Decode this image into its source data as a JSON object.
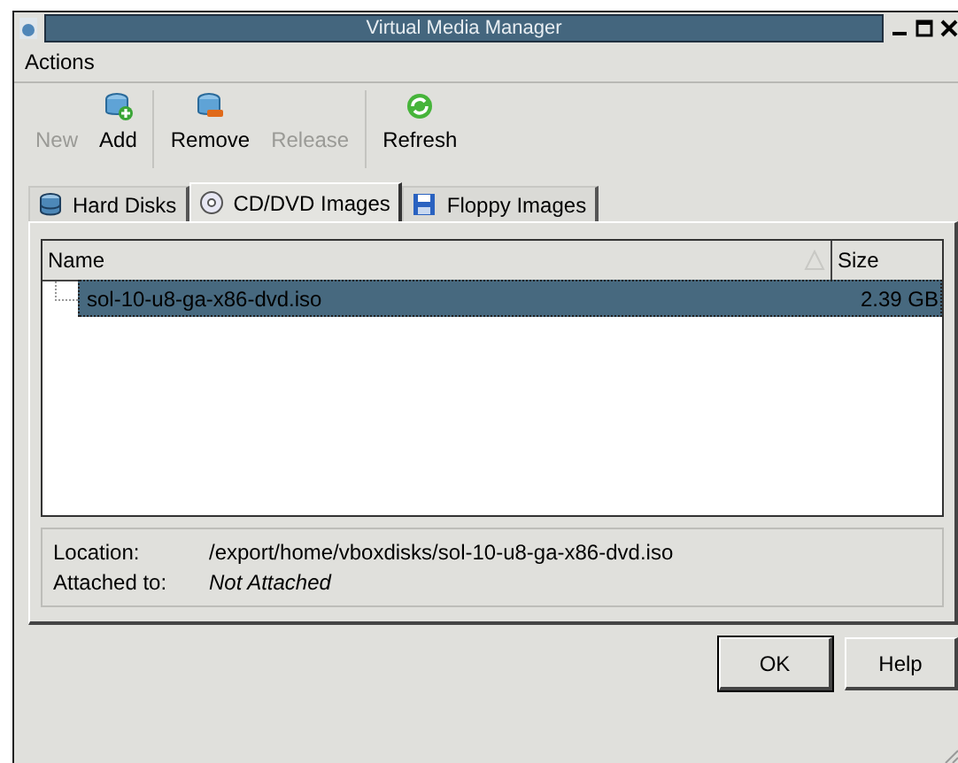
{
  "window": {
    "title": "Virtual Media Manager"
  },
  "menu": [
    "Actions"
  ],
  "toolbar": [
    {
      "label": "New",
      "kind": "plain",
      "disabled": true
    },
    {
      "label": "Add",
      "kind": "add",
      "disabled": false
    },
    {
      "label": "Remove",
      "kind": "remove",
      "disabled": false
    },
    {
      "label": "Release",
      "kind": "plain",
      "disabled": true
    },
    {
      "label": "Refresh",
      "kind": "refresh",
      "disabled": false
    }
  ],
  "tabs": [
    {
      "label": "Hard Disks",
      "kind": "disk",
      "selected": false
    },
    {
      "label": "CD/DVD Images",
      "kind": "cd",
      "selected": true
    },
    {
      "label": "Floppy Images",
      "kind": "floppy",
      "selected": false
    }
  ],
  "table": {
    "columns": [
      "Name",
      "Size"
    ],
    "rows": [
      {
        "name": "sol-10-u8-ga-x86-dvd.iso",
        "size": "2.39 GB",
        "selected": true
      }
    ]
  },
  "details": [
    {
      "label": "Location:",
      "value": "/export/home/vboxdisks/sol-10-u8-ga-x86-dvd.iso",
      "italic": false
    },
    {
      "label": "Attached to:",
      "value": "Not Attached",
      "italic": true
    }
  ],
  "buttons": [
    "OK",
    "Help"
  ]
}
